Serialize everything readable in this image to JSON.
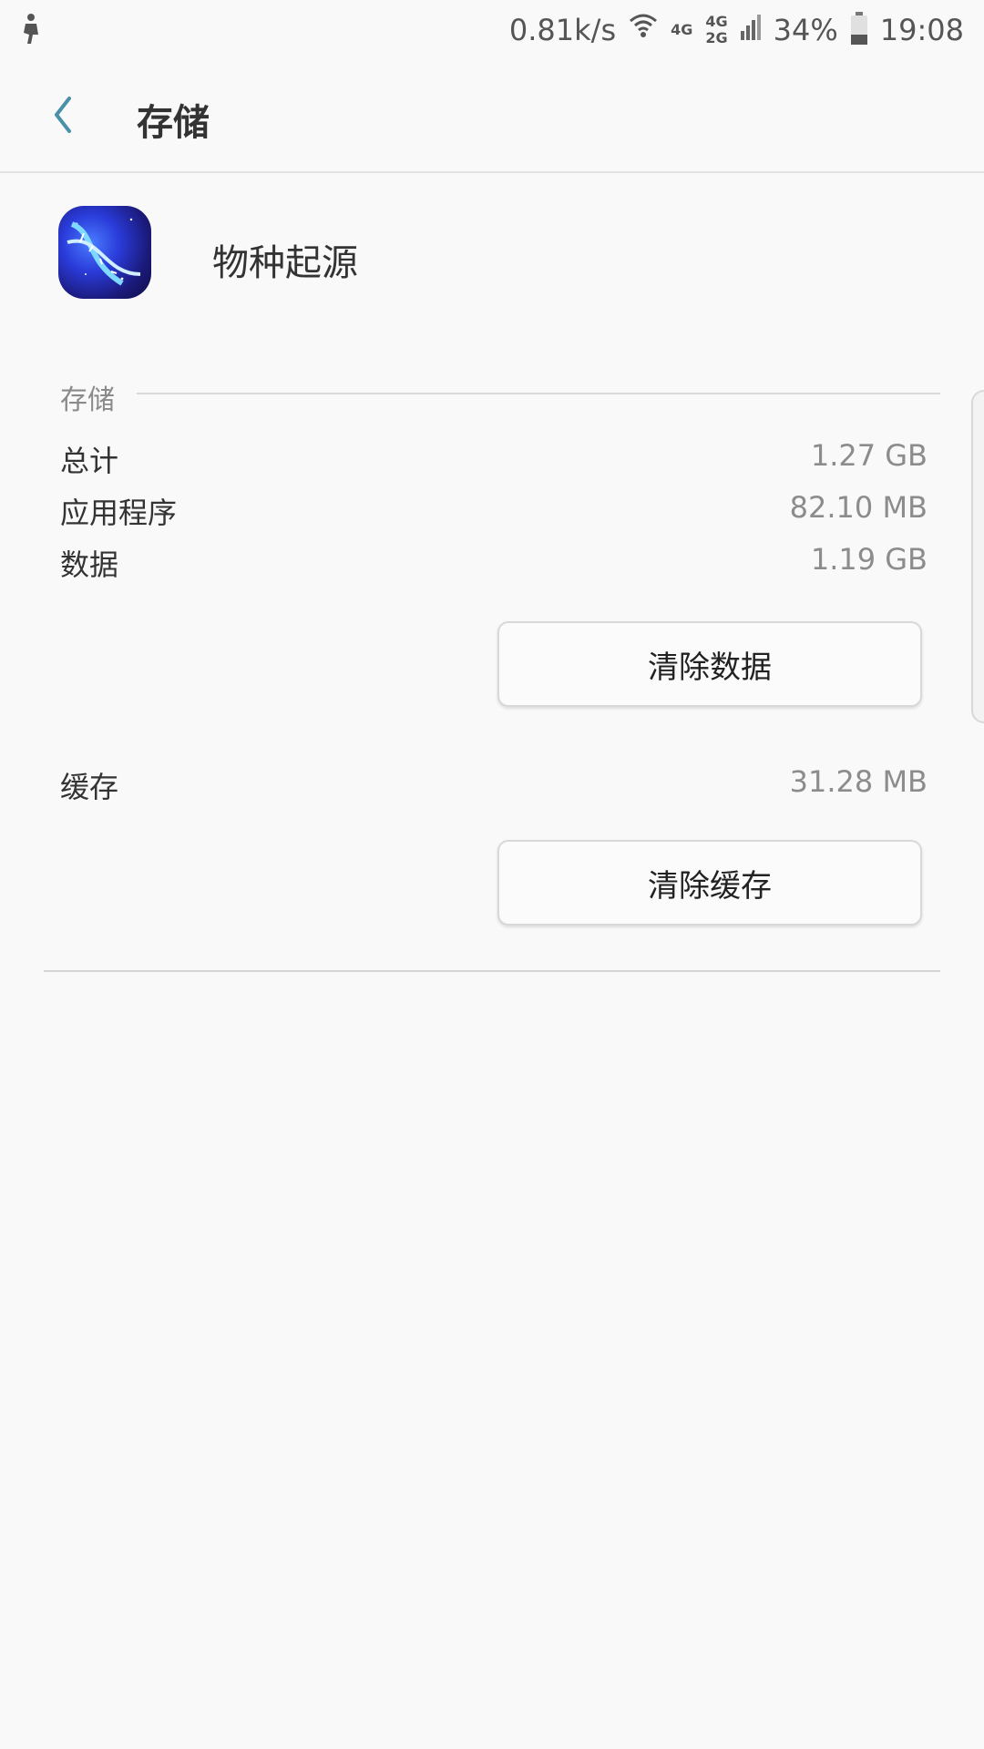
{
  "statusbar": {
    "speed": "0.81k/s",
    "net_top": "4G",
    "net_stack_top": "4G",
    "net_stack_bottom": "2G",
    "battery": "34%",
    "time": "19:08",
    "icons": [
      "notification-icon",
      "wifi-icon",
      "signal-icon",
      "battery-icon"
    ]
  },
  "header": {
    "title": "存储"
  },
  "app": {
    "name": "物种起源",
    "icon": "dna-app-icon"
  },
  "storage": {
    "section_label": "存储",
    "rows": [
      {
        "label": "总计",
        "value": "1.27 GB"
      },
      {
        "label": "应用程序",
        "value": "82.10 MB"
      },
      {
        "label": "数据",
        "value": "1.19 GB"
      }
    ],
    "clear_data_label": "清除数据"
  },
  "cache": {
    "label": "缓存",
    "value": "31.28 MB",
    "clear_cache_label": "清除缓存"
  },
  "colors": {
    "accent": "#4a90a8",
    "background": "#f9f9f9"
  }
}
